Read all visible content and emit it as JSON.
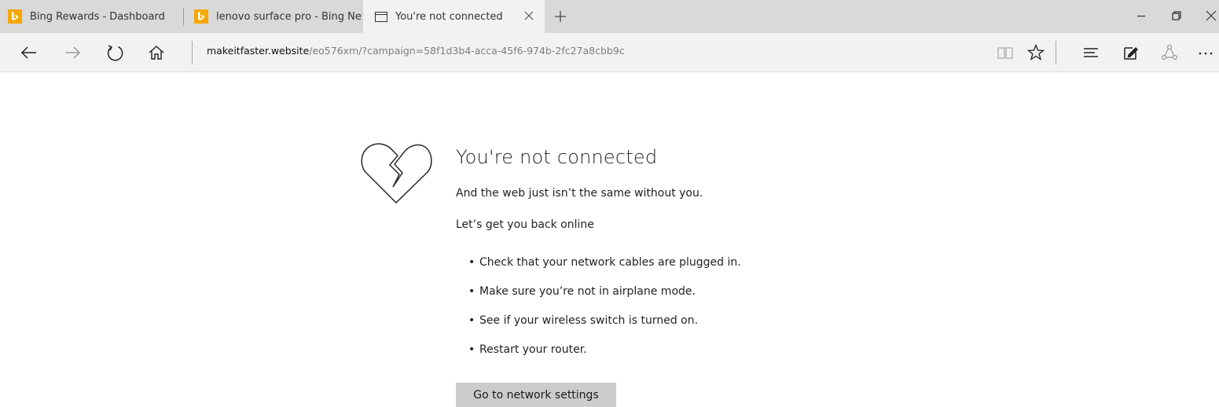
{
  "tabs": [
    {
      "label": "Bing Rewards - Dashboard",
      "icon": "bing-icon"
    },
    {
      "label": "lenovo surface pro - Bing News",
      "icon": "bing-icon"
    },
    {
      "label": "You're not connected",
      "icon": "page-icon",
      "active": true
    }
  ],
  "address": {
    "domain": "makeitfaster.website",
    "path": "/eo576xm/?campaign=58f1d3b4-acca-45f6-974b-2fc27a8cbb9c"
  },
  "error": {
    "title": "You're not connected",
    "subtitle": "And the web just isn’t the same without you.",
    "prompt": "Let’s get you back online",
    "tips": [
      "Check that your network cables are plugged in.",
      "Make sure you’re not in airplane mode.",
      "See if your wireless switch is turned on.",
      "Restart your router."
    ],
    "button_label": "Go to network settings"
  },
  "colors": {
    "tabstrip": "#d9d9d9",
    "toolbar": "#f2f2f2",
    "bing": "#f5a800",
    "button": "#cccccc"
  }
}
